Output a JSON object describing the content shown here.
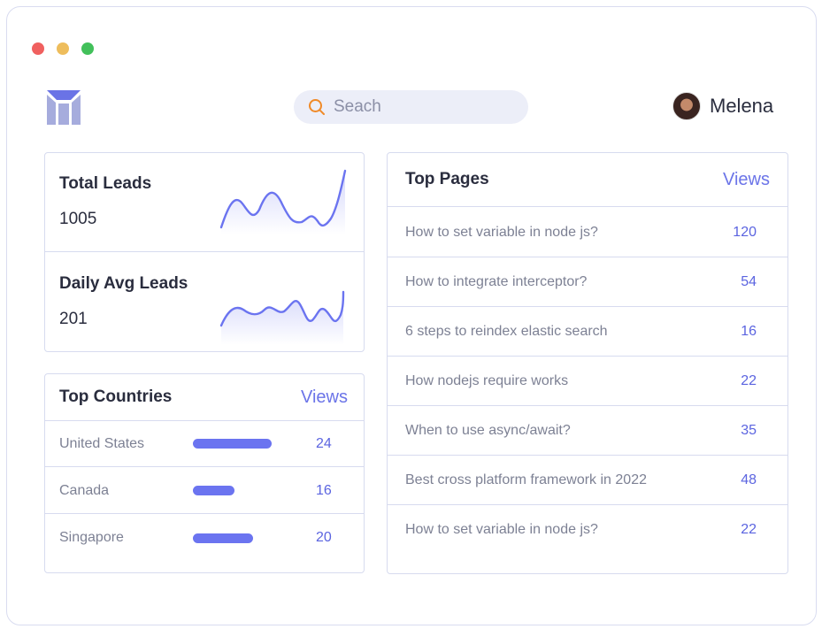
{
  "window": {
    "controls": [
      "close",
      "minimize",
      "maximize"
    ],
    "colors": {
      "close": "#f0605f",
      "minimize": "#eebd5c",
      "maximize": "#42c05a"
    }
  },
  "header": {
    "logo_icon": "brand-logo-icon",
    "search": {
      "placeholder": "Seach",
      "icon": "search-icon"
    },
    "user": {
      "name": "Melena",
      "avatar_icon": "avatar"
    }
  },
  "stats": [
    {
      "label": "Total Leads",
      "value": "1005"
    },
    {
      "label": "Daily Avg Leads",
      "value": "201"
    }
  ],
  "top_countries": {
    "title": "Top Countries",
    "link": "Views",
    "rows": [
      {
        "name": "United States",
        "value": "24",
        "bar_fraction": 1.0
      },
      {
        "name": "Canada",
        "value": "16",
        "bar_fraction": 0.53
      },
      {
        "name": "Singapore",
        "value": "20",
        "bar_fraction": 0.77
      }
    ]
  },
  "top_pages": {
    "title": "Top Pages",
    "link": "Views",
    "rows": [
      {
        "title": "How to set variable in node js?",
        "value": "120"
      },
      {
        "title": "How to integrate interceptor?",
        "value": "54"
      },
      {
        "title": "6 steps to reindex elastic search",
        "value": "16"
      },
      {
        "title": "How nodejs require works",
        "value": "22"
      },
      {
        "title": "When to use async/await?",
        "value": "35"
      },
      {
        "title": "Best cross platform framework in 2022",
        "value": "48"
      },
      {
        "title": "How to set variable in node js?",
        "value": "22"
      }
    ]
  },
  "accent_color": "#6b74f0"
}
